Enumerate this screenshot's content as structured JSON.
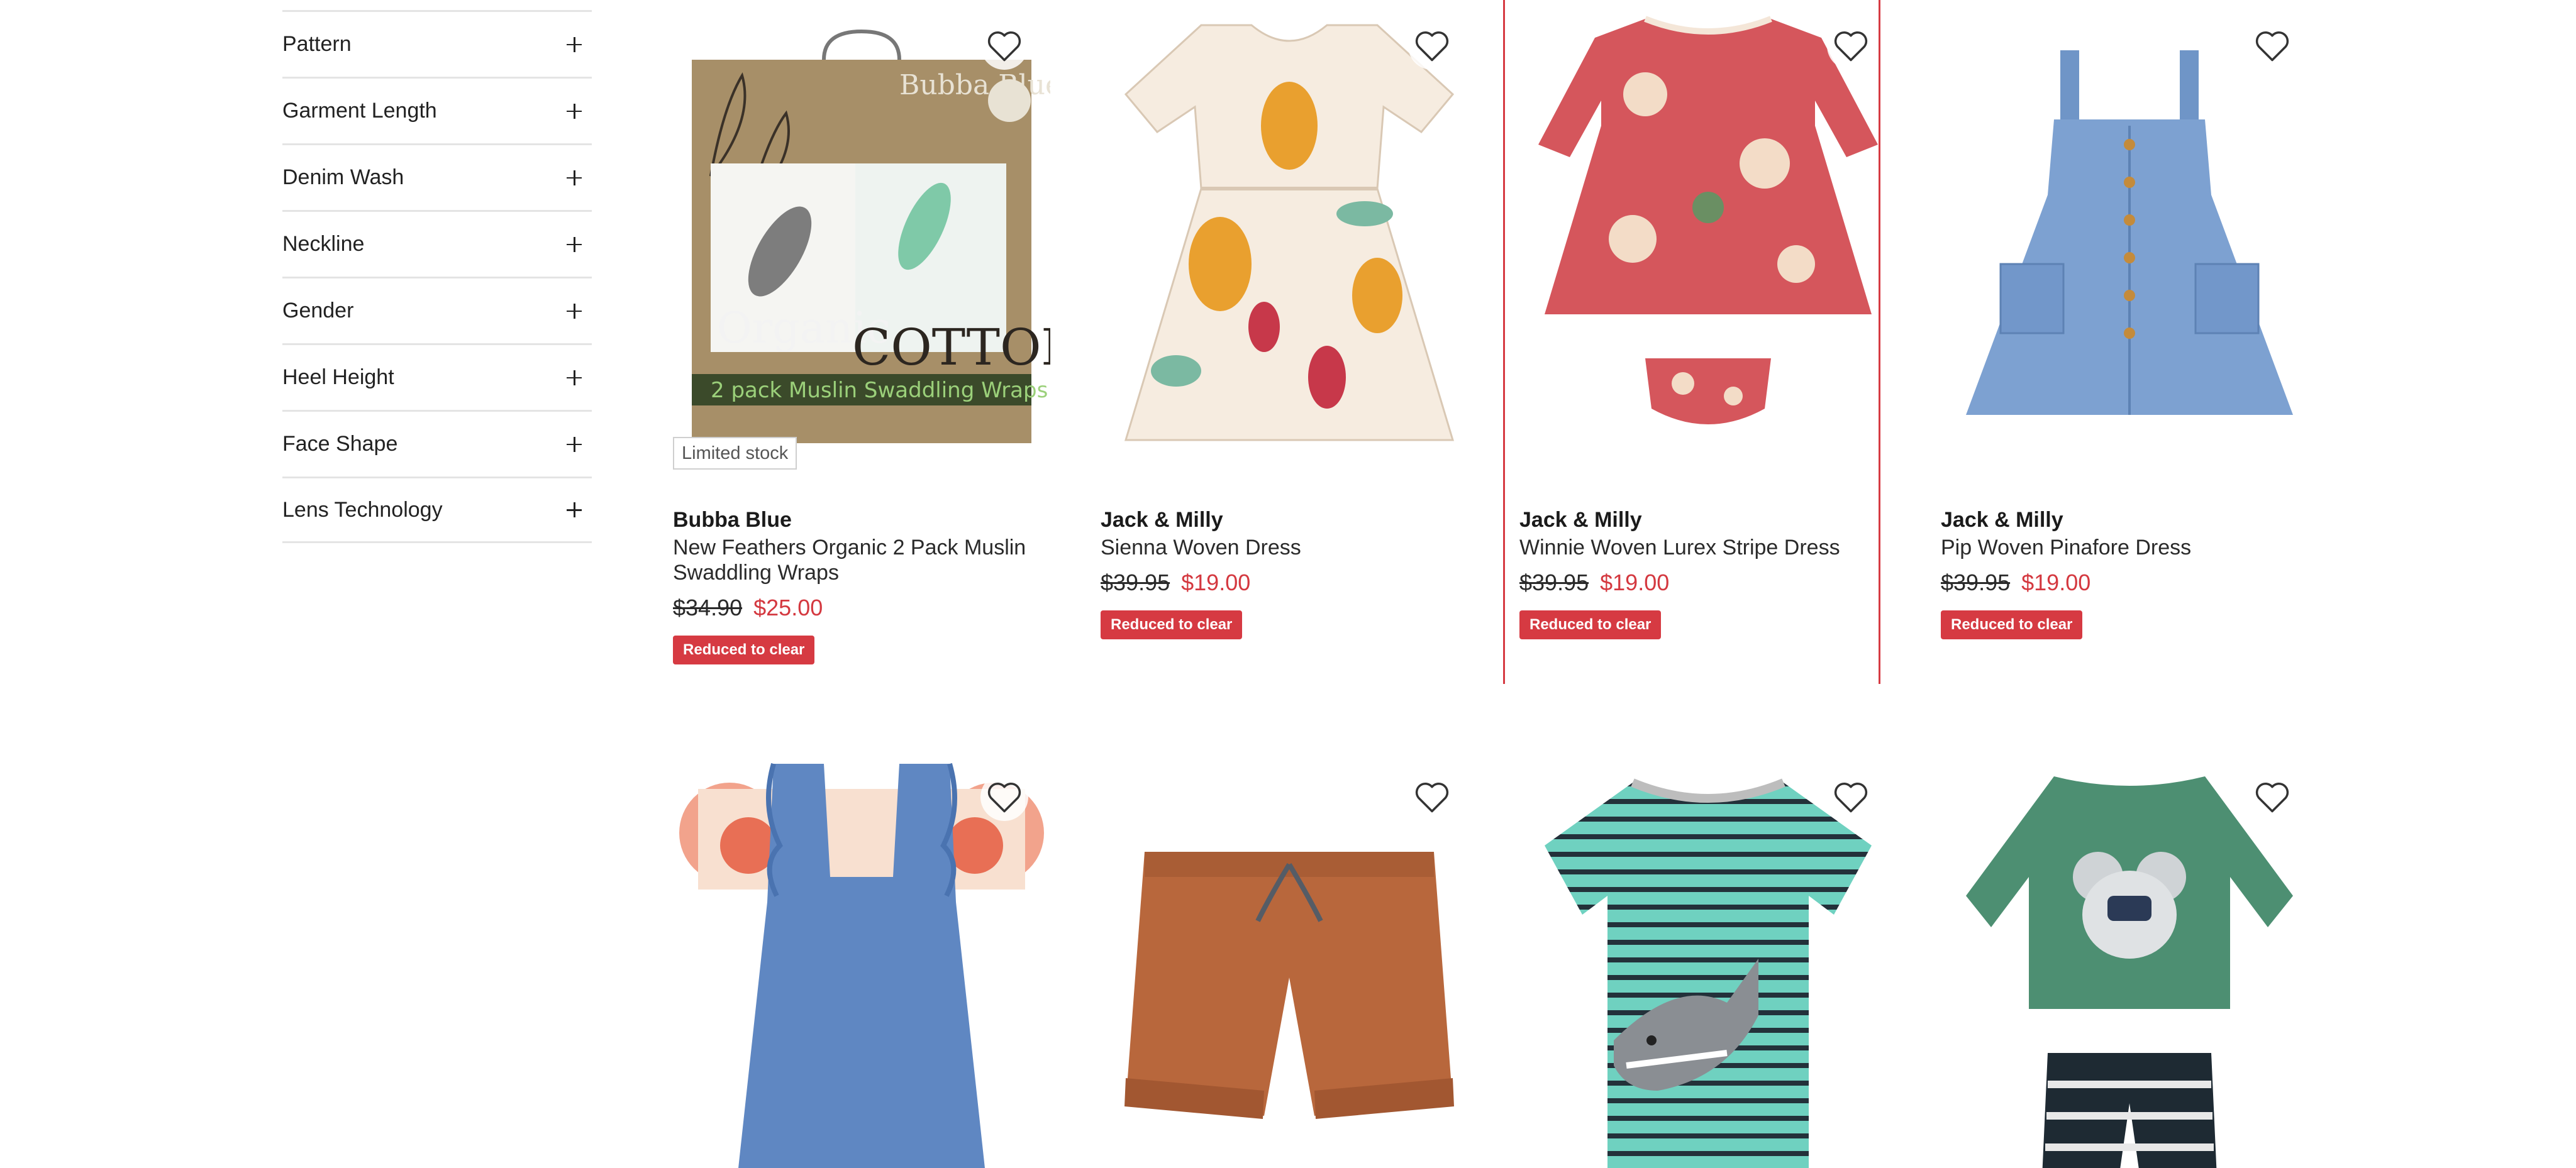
{
  "filters": [
    {
      "label": "Pattern"
    },
    {
      "label": "Garment Length"
    },
    {
      "label": "Denim Wash"
    },
    {
      "label": "Neckline"
    },
    {
      "label": "Gender"
    },
    {
      "label": "Heel Height"
    },
    {
      "label": "Face Shape"
    },
    {
      "label": "Lens Technology"
    }
  ],
  "products": [
    {
      "brand": "Bubba Blue",
      "name": "New Feathers Organic 2 Pack Muslin Swaddling Wraps",
      "was_price": "$34.90",
      "price": "$25.00",
      "badge": "Reduced to clear",
      "stock_label": "Limited stock",
      "image_icon": "swaddle-box-image"
    },
    {
      "brand": "Jack & Milly",
      "name": "Sienna Woven Dress",
      "was_price": "$39.95",
      "price": "$19.00",
      "badge": "Reduced to clear",
      "image_icon": "floral-dress-image"
    },
    {
      "brand": "Jack & Milly",
      "name": "Winnie Woven Lurex Stripe Dress",
      "was_price": "$39.95",
      "price": "$19.00",
      "badge": "Reduced to clear",
      "image_icon": "pink-dress-image"
    },
    {
      "brand": "Jack & Milly",
      "name": "Pip Woven Pinafore Dress",
      "was_price": "$39.95",
      "price": "$19.00",
      "badge": "Reduced to clear",
      "image_icon": "denim-pinafore-image"
    },
    {
      "image_icon": "denim-overall-image"
    },
    {
      "image_icon": "brown-shorts-image"
    },
    {
      "image_icon": "shark-tee-image"
    },
    {
      "image_icon": "koala-swim-set-image"
    }
  ],
  "colors": {
    "accent_red": "#d63a42",
    "sale_price": "#d4383f",
    "divider": "#e4e4e4"
  },
  "box_art": {
    "brand_text": "Bubba Blue",
    "word_organic": "Organic",
    "word_cotton": "COTTON",
    "band_text": "2 pack Muslin Swaddling Wraps"
  }
}
